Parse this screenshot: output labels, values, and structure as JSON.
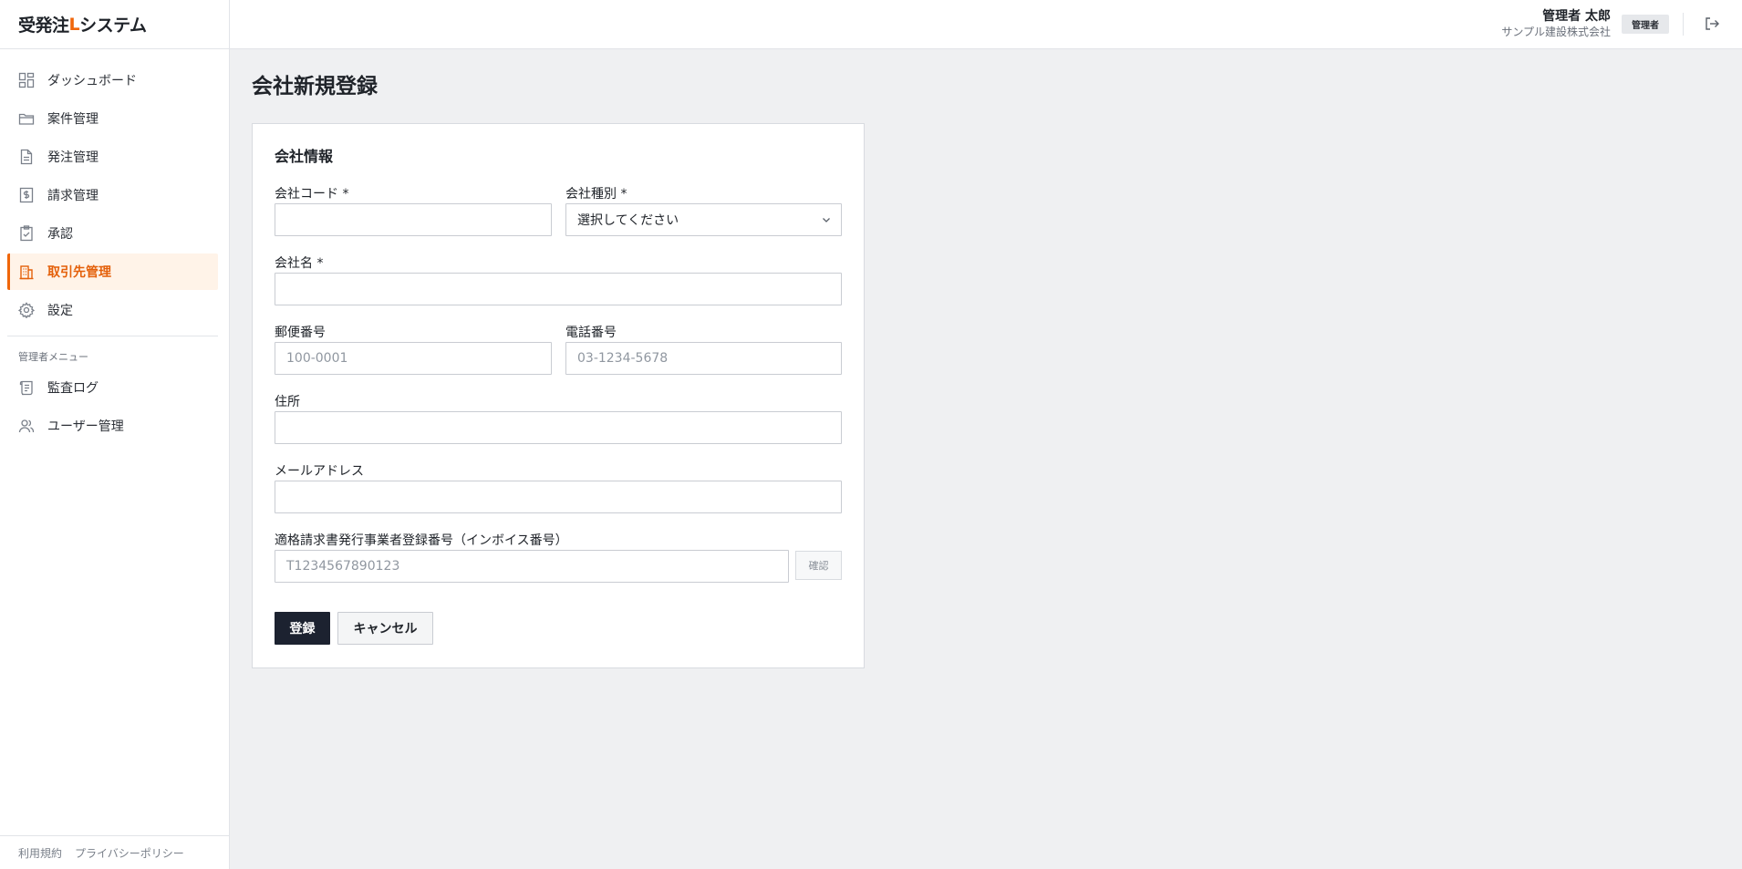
{
  "app": {
    "brand_prefix": "受発注",
    "brand_accent": "L",
    "brand_suffix": "システム",
    "accent_color": "#f0660a"
  },
  "sidebar": {
    "items": [
      {
        "label": "ダッシュボード",
        "icon": "dashboard-icon"
      },
      {
        "label": "案件管理",
        "icon": "folder-icon"
      },
      {
        "label": "発注管理",
        "icon": "document-icon"
      },
      {
        "label": "請求管理",
        "icon": "invoice-icon"
      },
      {
        "label": "承認",
        "icon": "clipboard-check-icon"
      },
      {
        "label": "取引先管理",
        "icon": "building-icon",
        "active": true
      },
      {
        "label": "設定",
        "icon": "gear-icon"
      }
    ],
    "admin_section_title": "管理者メニュー",
    "admin_items": [
      {
        "label": "監査ログ",
        "icon": "scroll-icon"
      },
      {
        "label": "ユーザー管理",
        "icon": "users-icon"
      }
    ],
    "footer": {
      "terms": "利用規約",
      "privacy": "プライバシーポリシー"
    }
  },
  "header": {
    "user_name": "管理者 太郎",
    "company": "サンプル建設株式会社",
    "role_badge": "管理者",
    "logout_icon": "logout-icon"
  },
  "page": {
    "title": "会社新規登録"
  },
  "form": {
    "section_title": "会社情報",
    "company_code": {
      "label": "会社コード *",
      "value": "",
      "placeholder": ""
    },
    "company_type": {
      "label": "会社種別 *",
      "selected": "選択してください"
    },
    "company_name": {
      "label": "会社名 *",
      "value": "",
      "placeholder": ""
    },
    "postal_code": {
      "label": "郵便番号",
      "value": "",
      "placeholder": "100-0001"
    },
    "phone": {
      "label": "電話番号",
      "value": "",
      "placeholder": "03-1234-5678"
    },
    "address": {
      "label": "住所",
      "value": "",
      "placeholder": ""
    },
    "email": {
      "label": "メールアドレス",
      "value": "",
      "placeholder": ""
    },
    "invoice_number": {
      "label": "適格請求書発行事業者登録番号（インボイス番号）",
      "value": "",
      "placeholder": "T1234567890123"
    },
    "confirm_button": "確認",
    "submit_button": "登録",
    "cancel_button": "キャンセル"
  }
}
